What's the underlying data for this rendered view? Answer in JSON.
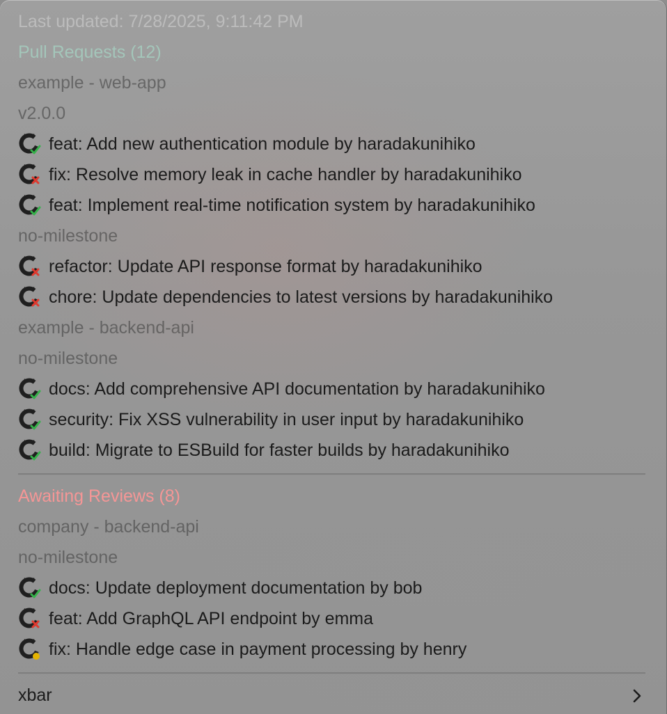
{
  "header": {
    "last_updated": "Last updated: 7/28/2025, 9:11:42 PM"
  },
  "pull_requests": {
    "title": "Pull Requests (12)",
    "repo_1": "example - web-app",
    "repo_1_group_1": "v2.0.0",
    "repo_1_group_2": "no-milestone",
    "repo_2": "example - backend-api",
    "repo_2_group_1": "no-milestone",
    "items": [
      {
        "label": "feat: Add new authentication module by haradakunihiko",
        "status": "success"
      },
      {
        "label": "fix: Resolve memory leak in cache handler by haradakunihiko",
        "status": "failure"
      },
      {
        "label": "feat: Implement real-time notification system by haradakunihiko",
        "status": "success"
      },
      {
        "label": "refactor: Update API response format by haradakunihiko",
        "status": "failure"
      },
      {
        "label": "chore: Update dependencies to latest versions by haradakunihiko",
        "status": "failure"
      },
      {
        "label": "docs: Add comprehensive API documentation by haradakunihiko",
        "status": "success"
      },
      {
        "label": "security: Fix XSS vulnerability in user input by haradakunihiko",
        "status": "success"
      },
      {
        "label": "build: Migrate to ESBuild for faster builds by haradakunihiko",
        "status": "success"
      }
    ]
  },
  "reviews": {
    "title": "Awaiting Reviews (8)",
    "repo_1": "company - backend-api",
    "repo_1_group_1": "no-milestone",
    "items": [
      {
        "label": "docs: Update deployment documentation by bob",
        "status": "success"
      },
      {
        "label": "feat: Add GraphQL API endpoint by emma",
        "status": "failure"
      },
      {
        "label": "fix: Handle edge case in payment processing by henry",
        "status": "pending"
      }
    ]
  },
  "footer": {
    "app_label": "xbar"
  },
  "icons": {
    "pr_icon": "github-icon",
    "success_badge": "check-icon",
    "failure_badge": "x-icon",
    "pending_badge": "dot-icon",
    "submenu": "chevron-right-icon"
  },
  "colors": {
    "success": "#35b24a",
    "failure": "#e0392e",
    "pending": "#e5b400",
    "prs_section": "#aae8d2",
    "reviews_section": "#ff9696"
  }
}
